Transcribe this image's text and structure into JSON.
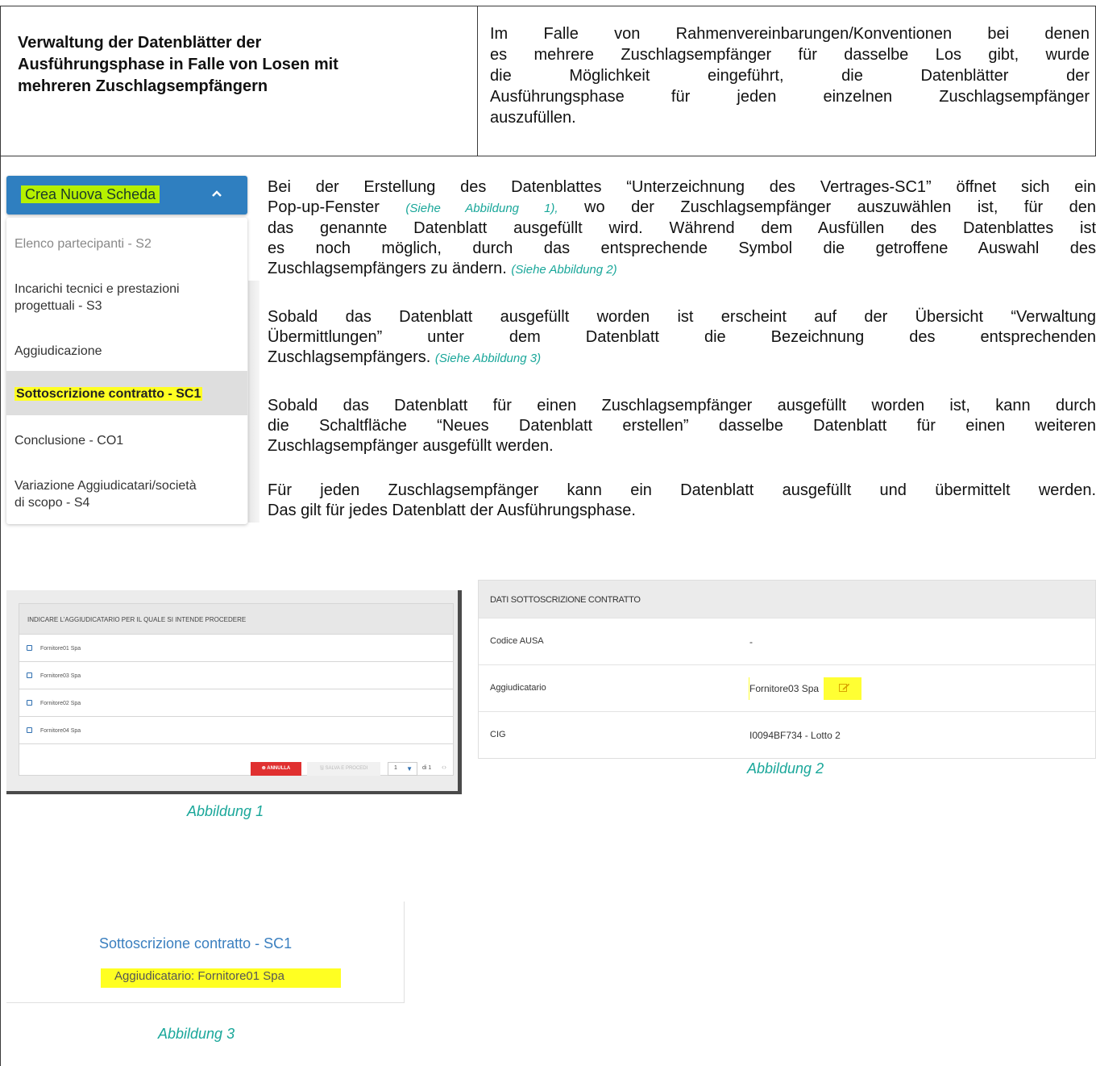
{
  "header": {
    "title_lines": [
      "Verwaltung der Datenblätter der",
      "Ausführungsphase in Falle von Losen mit",
      "mehreren Zuschlagsempfängern"
    ],
    "description_lines": [
      "Im Falle von Rahmenvereinbarungen/Konventionen bei denen",
      "es mehrere Zuschlagsempfänger für dasselbe Los gibt, wurde",
      "die  Möglichkeit  eingeführt,  die  Datenblätter  der",
      "Ausführungsphase für jeden einzelnen Zuschlagsempfänger",
      "auszufüllen."
    ]
  },
  "menu": {
    "button_label": "Crea Nuova Scheda",
    "chevron_icon": "chevron-up-icon",
    "items": [
      "Elenco partecipanti - S2",
      "Incarichi tecnici e prestazioni",
      "progettuali - S3",
      "Aggiudicazione",
      "Sottoscrizione contratto - SC1",
      "Conclusione - CO1",
      "Variazione Aggiudicatari/società",
      "di scopo - S4"
    ],
    "selected_index": 4,
    "highlight_color": "#ffff22",
    "button_color": "#2f7fc0"
  },
  "paragraphs": {
    "p1": {
      "line1": "Bei der Erstellung des Datenblattes “Unterzeichnung des Vertrages-SC1” öffnet sich ein",
      "line2_text": "Pop-up-Fenster ",
      "line2_ref": "(Siehe Abbildung 1),",
      "line2_rest": " wo der Zuschlagsempfänger auszuwählen ist, für den",
      "line3": "das genannte Datenblatt ausgefüllt wird. Während dem Ausfüllen des Datenblattes ist",
      "line4": "es noch möglich, durch das entsprechende Symbol die getroffene Auswahl des",
      "line5_text": "Zuschlagsempfängers zu ändern. ",
      "line5_ref": "(Siehe Abbildung 2)"
    },
    "p2": {
      "line1": "Sobald das Datenblatt ausgefüllt worden ist erscheint auf der Übersicht “Verwaltung",
      "line2": "Übermittlungen”  unter  dem  Datenblatt  die  Bezeichnung  des  entsprechenden",
      "line3_text": "Zuschlagsempfängers. ",
      "line3_ref": "(Siehe Abbildung 3)"
    },
    "p3": {
      "line1": "Sobald das Datenblatt für einen Zuschlagsempfänger ausgefüllt worden ist, kann durch",
      "line2": "die Schaltfläche “Neues Datenblatt erstellen” dasselbe Datenblatt für einen weiteren",
      "line3": "Zuschlagsempfänger ausgefüllt werden."
    },
    "p4": {
      "line1": "Für jeden Zuschlagsempfänger kann ein Datenblatt ausgefüllt und übermittelt werden.",
      "line2": "Das gilt für jedes Datenblatt der Ausführungsphase."
    }
  },
  "figure1": {
    "heading": "INDICARE L'AGGIUDICATARIO PER IL QUALE SI INTENDE PROCEDERE",
    "options": [
      "Fornitore01 Spa",
      "Fornitore03 Spa",
      "Fornitore02 Spa",
      "Fornitore04 Spa"
    ],
    "cancel_label": "⊗ ANNULLA",
    "save_label": "🖫 SALVA E PROCEDI",
    "page_select": "1",
    "page_of": "di 1",
    "caption": "Abbildung 1"
  },
  "figure2": {
    "heading": "DATI SOTTOSCRIZIONE CONTRATTO",
    "rows": [
      {
        "label": "Codice AUSA",
        "value": "-"
      },
      {
        "label": "Aggiudicatario",
        "value": "Fornitore03 Spa"
      },
      {
        "label": "CIG",
        "value": "I0094BF734 - Lotto 2"
      }
    ],
    "edit_icon": "edit-icon",
    "caption": "Abbildung 2"
  },
  "figure3": {
    "title": "Sottoscrizione contratto - SC1",
    "subtitle": "Aggiudicatario: Fornitore01 Spa",
    "caption": "Abbildung 3"
  },
  "colors": {
    "caption": "#1aa79a",
    "link_blue": "#3a7fbf",
    "highlight": "#ffff22"
  }
}
